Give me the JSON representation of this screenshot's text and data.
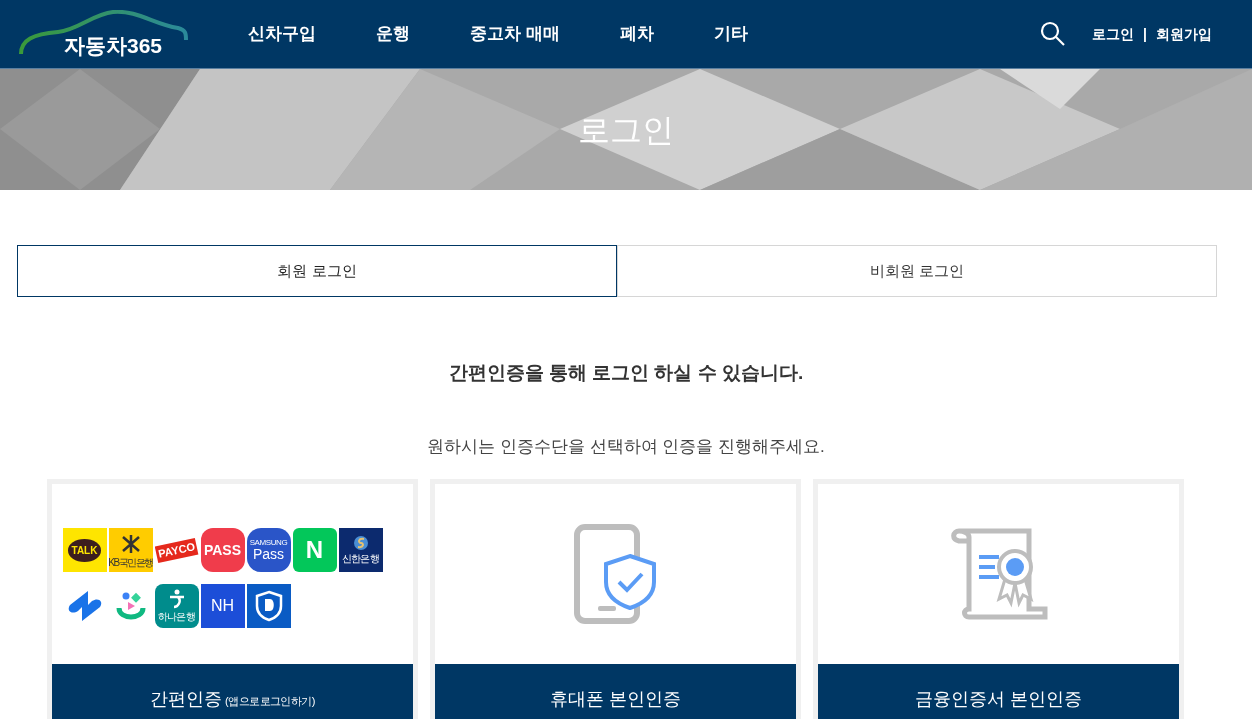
{
  "header": {
    "logo": "자동차365",
    "nav": [
      "신차구입",
      "운행",
      "중고차 매매",
      "폐차",
      "기타"
    ],
    "links": [
      "로그인",
      "회원가입"
    ],
    "separator": "|"
  },
  "banner": {
    "title": "로그인"
  },
  "tabs": [
    {
      "label": "회원 로그인",
      "selected": true
    },
    {
      "label": "비회원 로그인",
      "selected": false
    }
  ],
  "heading": "간편인증을 통해 로그인 하실 수 있습니다.",
  "subheading": "원하시는 인증수단을 선택하여 인증을 진행해주세요.",
  "cards": [
    {
      "kind": "apps",
      "title": "간편인증",
      "note": "(앱으로로그인하기)",
      "apps": [
        {
          "kind": "talk",
          "label": "TALK"
        },
        {
          "kind": "kb",
          "label": "KB국민은행"
        },
        {
          "kind": "payco",
          "label": "PAYCO"
        },
        {
          "kind": "pass",
          "label": "PASS"
        },
        {
          "kind": "samsung",
          "label": "SAMSUNG",
          "sub": "Pass"
        },
        {
          "kind": "naver",
          "label": "N"
        },
        {
          "kind": "shinhan",
          "label": "신한은행"
        },
        {
          "kind": "toss"
        },
        {
          "kind": "bank"
        },
        {
          "kind": "hana",
          "label": "하나은행"
        },
        {
          "kind": "nh",
          "label": "NH"
        },
        {
          "kind": "shield"
        }
      ]
    },
    {
      "kind": "phone",
      "title": "휴대폰 본인인증"
    },
    {
      "kind": "cert",
      "title": "금융인증서 본인인증"
    }
  ]
}
